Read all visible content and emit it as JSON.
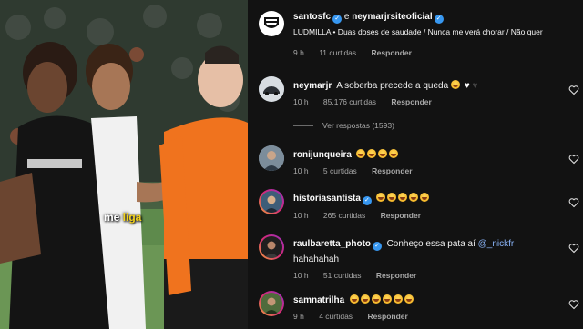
{
  "overlay": {
    "caption_before": "me ",
    "caption_highlight": "liga"
  },
  "comments_panel": {
    "post": {
      "username": "santosfc",
      "connector": "e",
      "coauthor": "neymarjrsiteoficial",
      "music": "LUDMILLA • Duas doses de saudade / Nunca me verá chorar / Não quer",
      "time": "9 h",
      "likes": "11 curtidas",
      "reply": "Responder"
    },
    "view_replies": "Ver respostas (1593)",
    "comments": [
      {
        "username": "neymarjr",
        "verified": false,
        "text": "A soberba precede a queda",
        "emoji": [
          "laughing-emoji",
          "white-heart-emoji",
          "black-heart-emoji"
        ],
        "time": "10 h",
        "likes": "85.176 curtidas",
        "reply": "Responder"
      },
      {
        "username": "ronijunqueira",
        "verified": false,
        "text": "",
        "emoji": [
          "laughing-emoji",
          "laughing-emoji",
          "laughing-emoji",
          "laughing-emoji"
        ],
        "time": "10 h",
        "likes": "5 curtidas",
        "reply": "Responder"
      },
      {
        "username": "historiasantista",
        "verified": true,
        "text": "",
        "emoji": [
          "laughing-emoji",
          "laughing-emoji",
          "laughing-emoji",
          "laughing-emoji",
          "laughing-emoji"
        ],
        "time": "10 h",
        "likes": "265 curtidas",
        "reply": "Responder"
      },
      {
        "username": "raulbaretta_photo",
        "verified": true,
        "text": "Conheço essa pata aí",
        "mention": "@_nickfr",
        "text2": "hahahahah",
        "time": "10 h",
        "likes": "51 curtidas",
        "reply": "Responder"
      },
      {
        "username": "samnatrilha",
        "verified": false,
        "text": "",
        "emoji": [
          "laughing-emoji",
          "laughing-emoji",
          "laughing-emoji",
          "laughing-emoji",
          "laughing-emoji",
          "laughing-emoji"
        ],
        "time": "9 h",
        "likes": "4 curtidas",
        "reply": "Responder"
      }
    ]
  },
  "icons": {
    "like": "heart-icon",
    "verified": "verified-badge-icon"
  },
  "colors": {
    "panel_bg": "#121212",
    "verified_blue": "#3797f0",
    "meta_gray": "#a8a8a8",
    "caption_yellow": "#f3d21c",
    "referee_orange": "#f0731e"
  }
}
